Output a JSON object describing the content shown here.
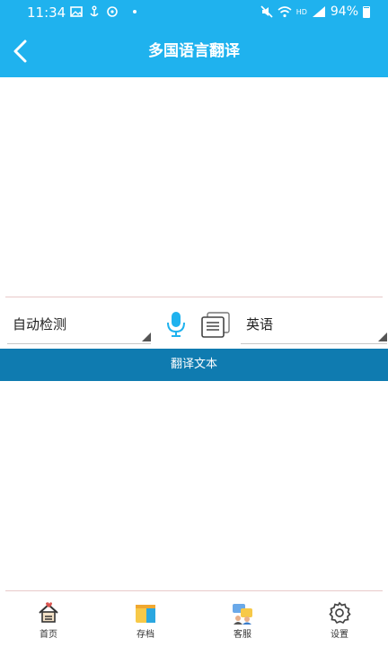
{
  "status_bar": {
    "time": "11:34",
    "battery": "94%",
    "network": "HD"
  },
  "header": {
    "title": "多国语言翻译",
    "back_icon": "chevron-left-icon"
  },
  "source": {
    "text": ""
  },
  "languages": {
    "source_label": "自动检测",
    "target_label": "英语",
    "mic_icon": "microphone-icon",
    "copy_icon": "copy-icon"
  },
  "translate_button": {
    "label": "翻译文本"
  },
  "result": {
    "text": ""
  },
  "bottom_nav": {
    "items": [
      {
        "label": "首页",
        "icon": "home-icon"
      },
      {
        "label": "存档",
        "icon": "folder-icon"
      },
      {
        "label": "客服",
        "icon": "customer-service-icon"
      },
      {
        "label": "设置",
        "icon": "gear-icon"
      }
    ]
  },
  "colors": {
    "header": "#1fb2ee",
    "translate_button": "#0f7bb0",
    "mic": "#1fb2ee"
  }
}
